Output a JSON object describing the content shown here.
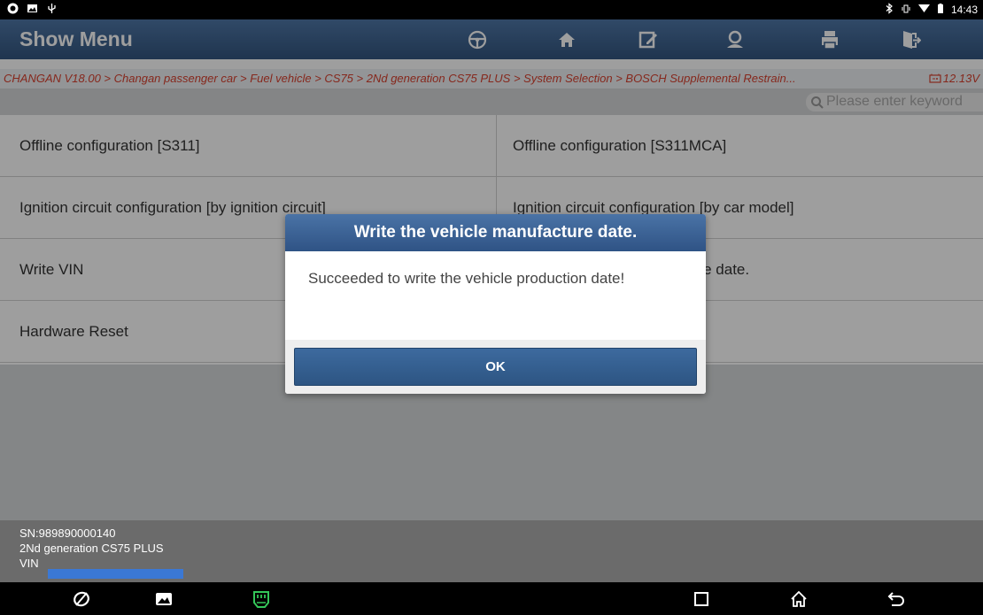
{
  "status_bar": {
    "time": "14:43"
  },
  "header": {
    "title": "Show Menu",
    "toolbar_icons": [
      "steering-wheel-icon",
      "home-icon",
      "edit-report-icon",
      "user-icon",
      "print-icon",
      "exit-icon"
    ]
  },
  "breadcrumb": {
    "path": "CHANGAN V18.00 > Changan passenger car > Fuel vehicle > CS75 > 2Nd generation CS75 PLUS > System Selection > BOSCH Supplemental Restrain...",
    "voltage": "12.13V"
  },
  "search": {
    "placeholder": "Please enter keyword"
  },
  "menu": {
    "rows": [
      {
        "left": "Offline configuration [S311]",
        "right": "Offline configuration [S311MCA]"
      },
      {
        "left": "Ignition circuit configuration [by ignition circuit]",
        "right": "Ignition circuit configuration [by car model]"
      },
      {
        "left": "Write VIN",
        "right": "Write the vehicle manufacture date."
      },
      {
        "left": "Hardware Reset",
        "right": ""
      }
    ]
  },
  "info": {
    "sn": "SN:989890000140",
    "model": "2Nd generation CS75 PLUS",
    "vin_label": "VIN"
  },
  "dialog": {
    "title": "Write the vehicle manufacture date.",
    "message": "Succeeded to write the vehicle production date!",
    "ok_label": "OK"
  },
  "colors": {
    "header": "#3d6293",
    "breadcrumb_text": "#d8412f",
    "dialog_title": "#3b6499",
    "vin_highlight": "#3b78d4"
  }
}
